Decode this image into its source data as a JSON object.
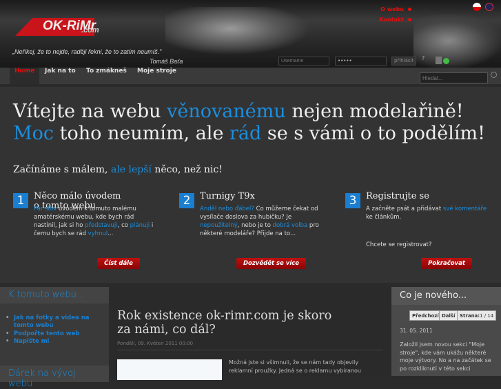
{
  "header": {
    "logo": "OK-RiMr",
    "logo_suffix": ".com",
    "quote": "„Neříkej, že to nejde, raději řekni, že to zatím neumíš.\"",
    "quote_author": "Tomáš Baťa",
    "links": [
      "O webu",
      "Kontakt"
    ],
    "username_placeholder": "Username",
    "password_value": "•••••",
    "login_label": "přihlásit",
    "help": "?"
  },
  "nav": {
    "items": [
      "Home",
      "Jak na to",
      "To zmákneš",
      "Moje stroje"
    ],
    "search_placeholder": "Hledat..."
  },
  "hero": {
    "h1_parts": [
      "Vítejte na webu ",
      "věnovanému",
      " nejen modelařině! ",
      "Moc",
      " toho neumím, ale ",
      "rád",
      " se s vámi o to podělím!"
    ],
    "h2_parts": [
      "Začínáme s málem, ",
      "ale lepší",
      " něco, než nic!"
    ],
    "columns": [
      {
        "num": "1",
        "title": "Něco málo úvodem o tomto webu",
        "text": [
          [
            "Pár slov",
            true
          ],
          [
            " úvodem k tomuto malému amatérskému webu, kde bych rád nastínil, jak si ho ",
            false
          ],
          [
            "představuji",
            true
          ],
          [
            ", co ",
            false
          ],
          [
            "plánuji",
            true
          ],
          [
            " i čemu bych se rád ",
            false
          ],
          [
            "vyhnul",
            true
          ],
          [
            "...",
            false
          ]
        ],
        "button": "Číst dále"
      },
      {
        "num": "2",
        "title": "Turnigy T9x",
        "text": [
          [
            "Anděl nebo ďábel?",
            true
          ],
          [
            " Co můžeme čekat od vysílače doslova za hubičku? Je ",
            false
          ],
          [
            "nepoužitelný",
            true
          ],
          [
            ", nebo je to ",
            false
          ],
          [
            "dobrá volba",
            true
          ],
          [
            " pro některé modeláře? Přijde na to...",
            false
          ]
        ],
        "button": "Dozvědět se více"
      },
      {
        "num": "3",
        "title": "Registrujte se",
        "text": [
          [
            "A začněte psát a přidávat ",
            false
          ],
          [
            "své komentáře",
            true
          ],
          [
            " ke článkům.",
            false
          ]
        ],
        "extra": "Chcete se registrovat?",
        "button": "Pokračovat"
      }
    ]
  },
  "left": {
    "heading": "K tomuto webu...",
    "items": [
      "Jak na fotky a videa na tomto webu",
      "Podpořte tento web",
      "Napište mi"
    ],
    "heading2": "Dárek na vývoj webu"
  },
  "article": {
    "title": "Rok existence ok-rimr.com je skoro za námi, co dál?",
    "date": "Pondělí, 09. Květen 2011 00:00",
    "excerpt": "Možná jste si všimnuli, že se nám tady objevily reklamní proužky. Jedná se o reklamu vybíranou"
  },
  "right": {
    "heading": "Co je nového...",
    "prev": "Předchozí",
    "next": "Další",
    "page_label": "Strana:",
    "page_value": "1 / 14",
    "date": "31. 05. 2011",
    "text": "Založil jsem novou sekci \"Moje stroje\", kde vám ukážu některé moje výtvory. No a na začátek se po rozkliknutí v této sekci"
  }
}
